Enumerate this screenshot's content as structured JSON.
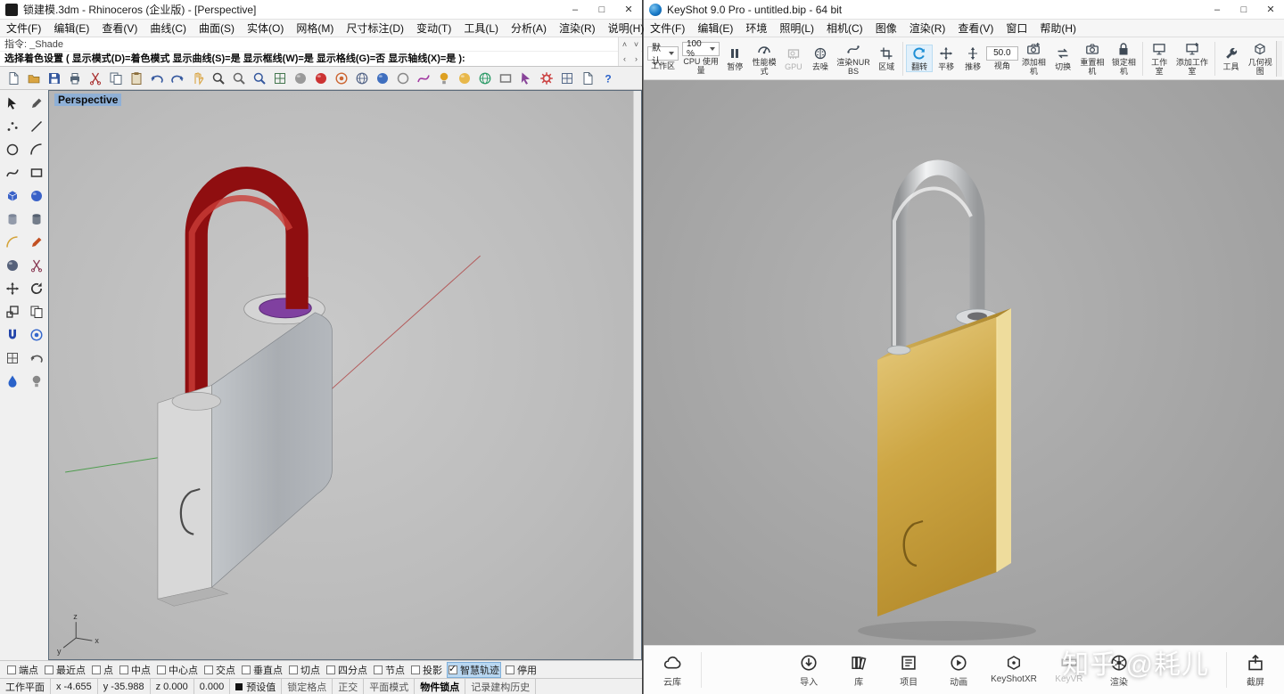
{
  "rhino": {
    "title": "锁建模.3dm - Rhinoceros (企业版) - [Perspective]",
    "window_buttons": {
      "min": "–",
      "max": "□",
      "close": "✕"
    },
    "menus": [
      "文件(F)",
      "编辑(E)",
      "查看(V)",
      "曲线(C)",
      "曲面(S)",
      "实体(O)",
      "网格(M)",
      "尺寸标注(D)",
      "变动(T)",
      "工具(L)",
      "分析(A)",
      "渲染(R)",
      "说明(H)"
    ],
    "command_history": "指令: _Shade",
    "command_prompt": "选择着色设置 ( 显示模式(D)=着色模式  显示曲线(S)=是  显示框线(W)=是  显示格线(G)=否  显示轴线(X)=是 ):",
    "cmd_nav_icons": [
      {
        "name": "scroll-up-icon",
        "glyph": "˄"
      },
      {
        "name": "scroll-down-icon",
        "glyph": "˅"
      },
      {
        "name": "history-back-icon",
        "glyph": "‹"
      },
      {
        "name": "history-forward-icon",
        "glyph": "›"
      }
    ],
    "viewport_label": "Perspective",
    "toolbar_icons": [
      {
        "name": "new-file",
        "shape": "file",
        "color": "#5a6b7d"
      },
      {
        "name": "open-file",
        "shape": "folder",
        "color": "#d9a441"
      },
      {
        "name": "save",
        "shape": "save",
        "color": "#35589e"
      },
      {
        "name": "print",
        "shape": "print",
        "color": "#556677"
      },
      {
        "name": "cut",
        "shape": "cut",
        "color": "#aa3333"
      },
      {
        "name": "copy",
        "shape": "copy",
        "color": "#556677"
      },
      {
        "name": "paste",
        "shape": "paste",
        "color": "#8a6d3b"
      },
      {
        "name": "undo",
        "shape": "undo",
        "color": "#35589e"
      },
      {
        "name": "redo",
        "shape": "redo",
        "color": "#35589e"
      },
      {
        "name": "pan",
        "shape": "hand",
        "color": "#d9a441"
      },
      {
        "name": "zoom-dynamic",
        "shape": "zoom",
        "color": "#444444"
      },
      {
        "name": "zoom-window",
        "shape": "zoom",
        "color": "#666666"
      },
      {
        "name": "zoom-extents",
        "shape": "zoom",
        "color": "#35589e"
      },
      {
        "name": "layer-table",
        "shape": "grid",
        "color": "#44774f"
      },
      {
        "name": "display-mode",
        "shape": "sphere",
        "color": "#9a9a9a"
      },
      {
        "name": "render",
        "shape": "sphere",
        "color": "#cc3333"
      },
      {
        "name": "render-region",
        "shape": "target",
        "color": "#cc6633"
      },
      {
        "name": "wireframe-view",
        "shape": "globe",
        "color": "#556688"
      },
      {
        "name": "shaded-view",
        "shape": "sphere",
        "color": "#3f6fbf"
      },
      {
        "name": "ghosted-view",
        "shape": "circle",
        "color": "#888888"
      },
      {
        "name": "curvature-analysis",
        "shape": "curve",
        "color": "#a23aa2"
      },
      {
        "name": "lights",
        "shape": "lamp",
        "color": "#dda022"
      },
      {
        "name": "sun",
        "shape": "sphere",
        "color": "#e8b84b"
      },
      {
        "name": "environment",
        "shape": "globe",
        "color": "#2a9a66"
      },
      {
        "name": "ground-plane",
        "shape": "rect",
        "color": "#777777"
      },
      {
        "name": "gumball-toggle",
        "shape": "arrow",
        "color": "#884499"
      },
      {
        "name": "options",
        "shape": "gear",
        "color": "#cc4444"
      },
      {
        "name": "layers-panel",
        "shape": "grid",
        "color": "#566a8a"
      },
      {
        "name": "properties-panel",
        "shape": "file",
        "color": "#556677"
      },
      {
        "name": "help",
        "shape": "question",
        "color": "#2a62c9"
      }
    ],
    "palette_icons": [
      {
        "name": "select",
        "shape": "arrow",
        "color": "#222222"
      },
      {
        "name": "lasso-select",
        "shape": "pencil",
        "color": "#555555"
      },
      {
        "name": "point",
        "shape": "points",
        "color": "#333333"
      },
      {
        "name": "polyline",
        "shape": "line",
        "color": "#333333"
      },
      {
        "name": "circle",
        "shape": "circle",
        "color": "#333333"
      },
      {
        "name": "arc",
        "shape": "arc",
        "color": "#333333"
      },
      {
        "name": "freeform-curve",
        "shape": "curve",
        "color": "#333333"
      },
      {
        "name": "rectangle",
        "shape": "rect",
        "color": "#333333"
      },
      {
        "name": "box",
        "shape": "box",
        "color": "#3a62c8"
      },
      {
        "name": "sphere",
        "shape": "sphere",
        "color": "#3a62c8"
      },
      {
        "name": "cylinder",
        "shape": "cyl",
        "color": "#7c8698"
      },
      {
        "name": "tube",
        "shape": "cyl",
        "color": "#556070"
      },
      {
        "name": "fillet",
        "shape": "arc",
        "color": "#d4a33a"
      },
      {
        "name": "chamfer",
        "shape": "pencil",
        "color": "#c25022"
      },
      {
        "name": "boolean-union",
        "shape": "sphere",
        "color": "#56617a"
      },
      {
        "name": "trim",
        "shape": "cut",
        "color": "#8a3b55"
      },
      {
        "name": "move",
        "shape": "move",
        "color": "#333333"
      },
      {
        "name": "rotate",
        "shape": "rotate",
        "color": "#333333"
      },
      {
        "name": "scale",
        "shape": "scale",
        "color": "#333333"
      },
      {
        "name": "mirror",
        "shape": "copy",
        "color": "#333333"
      },
      {
        "name": "object-snap",
        "shape": "magnet",
        "color": "#2244aa"
      },
      {
        "name": "gumball",
        "shape": "target",
        "color": "#3366cc"
      },
      {
        "name": "cplane",
        "shape": "grid",
        "color": "#555555"
      },
      {
        "name": "history",
        "shape": "undo",
        "color": "#555555"
      },
      {
        "name": "paint",
        "shape": "drop",
        "color": "#2a62c9"
      },
      {
        "name": "visibility",
        "shape": "lamp",
        "color": "#888888"
      }
    ],
    "osnap_items": [
      {
        "label": "端点",
        "checked": false
      },
      {
        "label": "最近点",
        "checked": false
      },
      {
        "label": "点",
        "checked": false
      },
      {
        "label": "中点",
        "checked": false
      },
      {
        "label": "中心点",
        "checked": false
      },
      {
        "label": "交点",
        "checked": false
      },
      {
        "label": "垂直点",
        "checked": false
      },
      {
        "label": "切点",
        "checked": false
      },
      {
        "label": "四分点",
        "checked": false
      },
      {
        "label": "节点",
        "checked": false
      },
      {
        "label": "投影",
        "checked": false
      },
      {
        "label": "智慧轨迹",
        "checked": true,
        "highlight": true
      },
      {
        "label": "停用",
        "checked": false
      }
    ],
    "status": {
      "cplane": "工作平面",
      "x": "x -4.655",
      "y": "y -35.988",
      "z": "z 0.000",
      "delta": "0.000",
      "preset": "预设值",
      "toggles": [
        {
          "label": "锁定格点",
          "active": false
        },
        {
          "label": "正交",
          "active": false
        },
        {
          "label": "平面模式",
          "active": false
        },
        {
          "label": "物件锁点",
          "active": true
        },
        {
          "label": "记录建构历史",
          "active": false
        }
      ]
    },
    "gizmo_labels": {
      "x": "x",
      "y": "y",
      "z": "z"
    }
  },
  "keyshot": {
    "title": "KeyShot 9.0 Pro  - untitled.bip  - 64 bit",
    "window_buttons": {
      "min": "–",
      "max": "□",
      "close": "✕"
    },
    "menus": [
      "文件(F)",
      "编辑(E)",
      "环境",
      "照明(L)",
      "相机(C)",
      "图像",
      "渲染(R)",
      "查看(V)",
      "窗口",
      "帮助(H)"
    ],
    "ribbon": [
      {
        "type": "dropdown",
        "value": "默认",
        "label": "工作区",
        "name": "workspace"
      },
      {
        "type": "dropdown",
        "value": "100 %",
        "label": "CPU 使用量",
        "name": "cpu-usage"
      },
      {
        "type": "button",
        "icon": "pause",
        "label": "暂停",
        "name": "pause"
      },
      {
        "type": "button",
        "icon": "gauge",
        "label": "性能模式",
        "name": "performance-mode"
      },
      {
        "type": "button",
        "icon": "gpu",
        "label": "GPU",
        "name": "gpu-mode",
        "disabled": true
      },
      {
        "type": "button",
        "icon": "denoise",
        "label": "去噪",
        "name": "denoise"
      },
      {
        "type": "button",
        "icon": "nurbs",
        "label": "渲染NURBS",
        "name": "render-nurbs"
      },
      {
        "type": "button",
        "icon": "region",
        "label": "区域",
        "name": "region"
      },
      {
        "type": "sep"
      },
      {
        "type": "button",
        "icon": "tumble",
        "label": "翻转",
        "name": "tumble",
        "active": true
      },
      {
        "type": "button",
        "icon": "move",
        "label": "平移",
        "name": "pan"
      },
      {
        "type": "button",
        "icon": "dolly",
        "label": "推移",
        "name": "dolly"
      },
      {
        "type": "input",
        "value": "50.0",
        "label": "视角",
        "name": "fov"
      },
      {
        "type": "button",
        "icon": "cameraAdd",
        "label": "添加相机",
        "name": "add-camera"
      },
      {
        "type": "button",
        "icon": "swap",
        "label": "切换",
        "name": "switch-camera"
      },
      {
        "type": "button",
        "icon": "camera",
        "label": "重置相机",
        "name": "reset-camera"
      },
      {
        "type": "button",
        "icon": "lock",
        "label": "锁定相机",
        "name": "lock-camera"
      },
      {
        "type": "sep"
      },
      {
        "type": "button",
        "icon": "studio",
        "label": "工作室",
        "name": "studio"
      },
      {
        "type": "button",
        "icon": "studioAdd",
        "label": "添加工作室",
        "name": "add-studio"
      },
      {
        "type": "sep"
      },
      {
        "type": "button",
        "icon": "wrench",
        "label": "工具",
        "name": "tools"
      },
      {
        "type": "button",
        "icon": "geometry",
        "label": "几何视图",
        "name": "geometry-view"
      }
    ],
    "dock": [
      {
        "icon": "cloud",
        "label": "云库",
        "name": "cloud-library"
      },
      {
        "icon": "import",
        "label": "导入",
        "name": "import"
      },
      {
        "icon": "library",
        "label": "库",
        "name": "library"
      },
      {
        "icon": "project",
        "label": "项目",
        "name": "project"
      },
      {
        "icon": "animation",
        "label": "动画",
        "name": "animation"
      },
      {
        "icon": "xr",
        "label": "KeyShotXR",
        "name": "keyshot-xr"
      },
      {
        "icon": "vr",
        "label": "KeyVR",
        "name": "keyvr",
        "disabled": true
      },
      {
        "icon": "render",
        "label": "渲染",
        "name": "render"
      },
      {
        "icon": "screenshot",
        "label": "截屏",
        "name": "screenshot"
      }
    ],
    "watermark": "知乎 @耗儿"
  }
}
